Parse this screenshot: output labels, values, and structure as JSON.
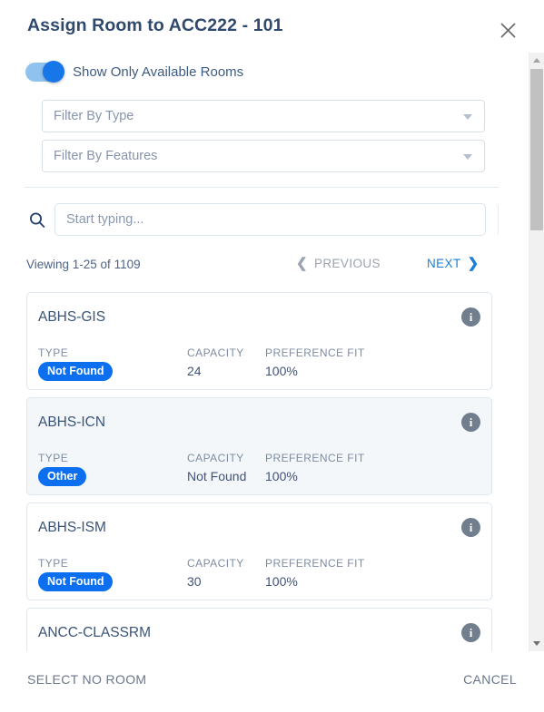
{
  "header": {
    "title": "Assign Room to ACC222 - 101",
    "close_icon": "close-icon"
  },
  "toggle": {
    "label": "Show Only Available Rooms",
    "state": "on",
    "on_color": "#1877e8",
    "track_color": "#90c2f0"
  },
  "filters": [
    {
      "name": "filter-by-type",
      "placeholder": "Filter By Type",
      "value": ""
    },
    {
      "name": "filter-by-features",
      "placeholder": "Filter By Features",
      "value": ""
    }
  ],
  "search": {
    "icon": "search-icon",
    "placeholder": "Start typing...",
    "value": ""
  },
  "pagination": {
    "viewing": "Viewing 1-25 of 1109",
    "previous_label": "PREVIOUS",
    "next_label": "NEXT",
    "previous_enabled": false,
    "next_enabled": true,
    "previous_color": "#9aa3b0",
    "next_color": "#1c7ed6"
  },
  "columns": {
    "type": "TYPE",
    "capacity": "CAPACITY",
    "preference_fit": "PREFERENCE FIT"
  },
  "rooms": [
    {
      "name": "ABHS-GIS",
      "type": "Not Found",
      "capacity": "24",
      "preference_fit": "100%",
      "highlighted": false,
      "info_icon": "info-icon"
    },
    {
      "name": "ABHS-ICN",
      "type": "Other",
      "capacity": "Not Found",
      "preference_fit": "100%",
      "highlighted": true,
      "info_icon": "info-icon"
    },
    {
      "name": "ABHS-ISM",
      "type": "Not Found",
      "capacity": "30",
      "preference_fit": "100%",
      "highlighted": false,
      "info_icon": "info-icon"
    },
    {
      "name": "ANCC-CLASSRM",
      "type": "",
      "capacity": "",
      "preference_fit": "",
      "highlighted": false,
      "info_icon": "info-icon"
    }
  ],
  "footer": {
    "select_no_room_label": "SELECT NO ROOM",
    "cancel_label": "CANCEL"
  },
  "colors": {
    "badge_blue": "#0b6ff0",
    "title_navy": "#2f4a6d",
    "card_hover": "#f4f7fa",
    "scrollbar_thumb": "#c1c1c1"
  }
}
